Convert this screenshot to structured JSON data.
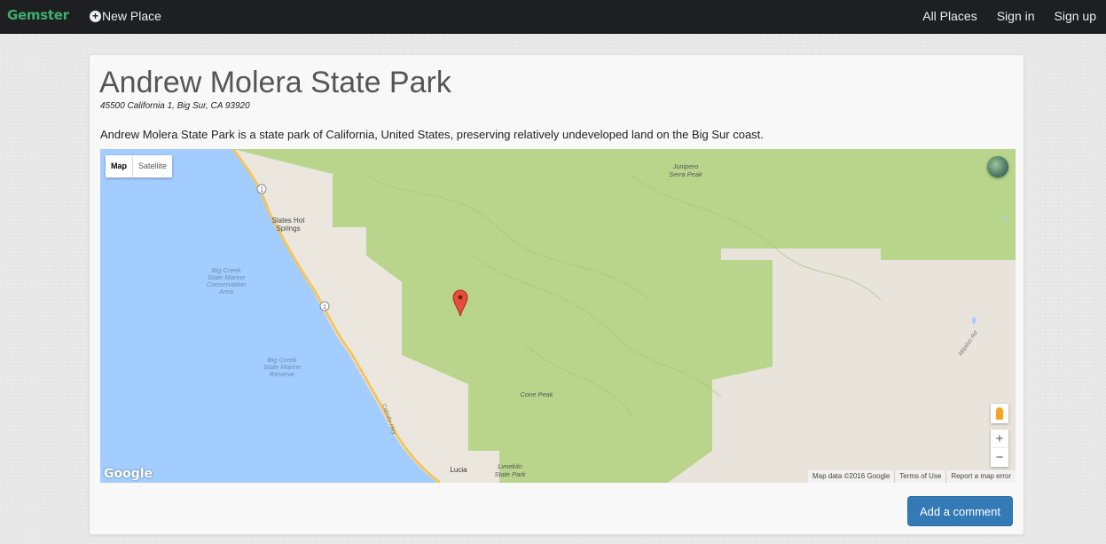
{
  "nav": {
    "brand": "Gemster",
    "new_place": "New Place",
    "all_places": "All Places",
    "sign_in": "Sign in",
    "sign_up": "Sign up"
  },
  "place": {
    "name": "Andrew Molera State Park",
    "address": "45500 California 1, Big Sur, CA 93920",
    "description": "Andrew Molera State Park is a state park of California, United States, preserving relatively undeveloped land on the Big Sur coast."
  },
  "map": {
    "type_map": "Map",
    "type_satellite": "Satellite",
    "labels": {
      "junipero": "Junipero",
      "serra_peak": "Serra Peak",
      "slates_hot": "Slates Hot",
      "springs": "Springs",
      "big_creek_1": "Big Creek",
      "state_marine_1": "State Marine",
      "conservation": "Conservation",
      "area": "Area",
      "big_creek_2": "Big Creek",
      "state_marine_2": "State Marine",
      "reserve": "Reserve",
      "cone_peak": "Cone Peak",
      "cabrillo_hwy": "Cabrillo Hwy",
      "lucia": "Lucia",
      "limekiln": "Limekiln",
      "state_park": "State Park",
      "milpitas_rd": "Milpitas Rd",
      "route_1": "1"
    },
    "google": "Google",
    "attribution": "Map data ©2016 Google",
    "terms": "Terms of Use",
    "report": "Report a map error",
    "zoom_in": "+",
    "zoom_out": "−"
  },
  "actions": {
    "add_comment": "Add a comment"
  },
  "colors": {
    "navbar": "#1d1f20",
    "brand": "#3fae6e",
    "ocean": "#a3ccff",
    "park_green": "#b9d58c",
    "land": "#e8e4dc",
    "road": "#f4c55c",
    "marker": "#e74c3c",
    "button": "#337ab7"
  }
}
